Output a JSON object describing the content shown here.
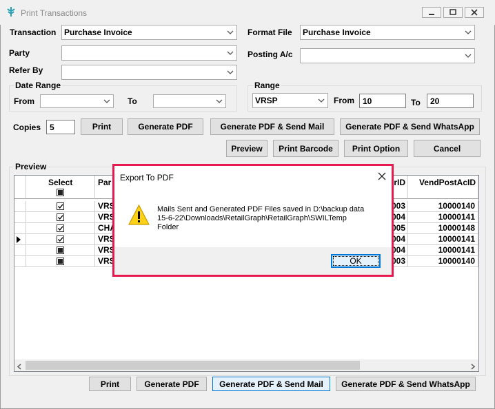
{
  "window": {
    "title": "Print Transactions"
  },
  "form": {
    "transaction_label": "Transaction",
    "transaction_value": "Purchase Invoice",
    "format_file_label": "Format File",
    "format_file_value": "Purchase Invoice",
    "party_label": "Party",
    "party_value": "",
    "posting_label": "Posting A/c",
    "posting_value": "",
    "refer_by_label": "Refer By",
    "refer_by_value": "",
    "date_range_label": "Date Range",
    "from_label": "From",
    "to_label": "To",
    "date_from_value": "",
    "date_to_value": "",
    "range_label": "Range",
    "range_type_value": "VRSP",
    "range_from_label": "From",
    "range_from_value": "10",
    "range_to_label": "To",
    "range_to_value": "20",
    "copies_label": "Copies",
    "copies_value": "5"
  },
  "toolbar": {
    "print": "Print",
    "generate_pdf": "Generate PDF",
    "generate_pdf_mail": "Generate PDF & Send Mail",
    "generate_pdf_whatsapp": "Generate PDF & Send WhatsApp",
    "preview": "Preview",
    "print_barcode": "Print Barcode",
    "print_option": "Print Option",
    "cancel": "Cancel"
  },
  "preview": {
    "label": "Preview",
    "columns": [
      "Select",
      "Par",
      "rID",
      "VendPostAcID"
    ],
    "rows": [
      {
        "checked": true,
        "party": "VRS",
        "rid": "003",
        "vend": "10000140"
      },
      {
        "checked": true,
        "party": "VRS",
        "rid": "004",
        "vend": "10000141"
      },
      {
        "checked": true,
        "party": "CHA",
        "rid": "005",
        "vend": "10000148"
      },
      {
        "checked": true,
        "party": "VRS",
        "rid": "004",
        "vend": "10000141"
      },
      {
        "checked": false,
        "party": "VRS",
        "rid": "004",
        "vend": "10000141"
      },
      {
        "checked": false,
        "party": "VRS",
        "rid": "003",
        "vend": "10000140"
      }
    ]
  },
  "bottom_buttons": {
    "print": "Print",
    "generate_pdf": "Generate PDF",
    "generate_pdf_mail": "Generate PDF & Send Mail",
    "generate_pdf_whatsapp": "Generate PDF & Send WhatsApp"
  },
  "dialog": {
    "title": "Export To PDF",
    "message_line1": "Mails Sent and Generated PDF Files saved in D:\\backup data",
    "message_line2": "15-6-22\\Downloads\\RetailGraph\\RetailGraph\\SWILTemp",
    "message_line3": "Folder",
    "ok": "OK",
    "icon": "warning-icon"
  }
}
